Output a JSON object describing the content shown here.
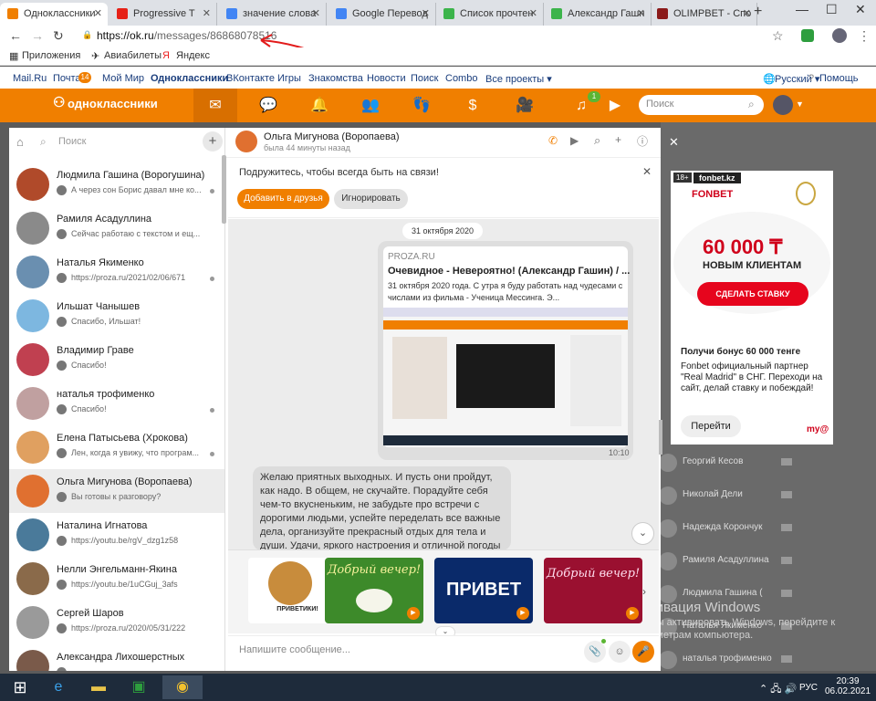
{
  "browser": {
    "tabs": [
      {
        "label": "Одноклассники",
        "color": "#f07f00",
        "active": true
      },
      {
        "label": "Progressive T",
        "color": "#e62117"
      },
      {
        "label": "значение слова",
        "color": "#4285f4"
      },
      {
        "label": "Google Перевод",
        "color": "#4285f4"
      },
      {
        "label": "Список прочтен",
        "color": "#3cb44b"
      },
      {
        "label": "Александр Гашн",
        "color": "#3cb44b"
      },
      {
        "label": "OLIMPBET - Спо",
        "color": "#8b1a1a"
      }
    ],
    "url_host": "https://ok.ru",
    "url_path": "/messages/86868078516",
    "bookmarks": [
      "Приложения",
      "Авиабилеты",
      "Яндекс"
    ]
  },
  "portal": {
    "links": [
      "Mail.Ru",
      "Почта",
      "Мой Мир",
      "Одноклассники",
      "ВКонтакте",
      "Игры",
      "Знакомства",
      "Новости",
      "Поиск",
      "Combo",
      "Все проекты ▾"
    ],
    "mail_badge": "14",
    "lang": "Русский ▾",
    "help": "Помощь"
  },
  "ok": {
    "logo": "одноклассники",
    "search_placeholder": "Поиск",
    "music_badge": "1"
  },
  "sidebar": {
    "search_placeholder": "Поиск",
    "chats": [
      {
        "name": "Людмила Гашина (Ворогушина)",
        "preview": "А через сон Борис давал мне ко...",
        "color": "#b04a2a"
      },
      {
        "name": "Рамиля Асадуллина",
        "preview": "Сейчас работаю с текстом и ещ...",
        "color": "#8a8a8a"
      },
      {
        "name": "Наталья Якименко",
        "preview": "https://proza.ru/2021/02/06/671",
        "color": "#6a8fb0"
      },
      {
        "name": "Ильшат Чанышев",
        "preview": "Спасибо, Ильшат!",
        "color": "#7db7e0"
      },
      {
        "name": "Владимир Граве",
        "preview": "Спасибо!",
        "color": "#c04050"
      },
      {
        "name": "наталья трофименко",
        "preview": "Спасибо!",
        "color": "#c0a0a0"
      },
      {
        "name": "Елена Патысьева (Хрокова)",
        "preview": "Лен, когда я увижу, что програм...",
        "color": "#e0a060"
      },
      {
        "name": "Ольга Мигунова (Воропаева)",
        "preview": "Вы готовы к разговору?",
        "color": "#e07030"
      },
      {
        "name": "Наталина Игнатова",
        "preview": "https://youtu.be/rgV_dzg1z58",
        "color": "#4a7a9a"
      },
      {
        "name": "Нелли Энгельманн-Якина",
        "preview": "https://youtu.be/1uCGuj_3afs",
        "color": "#8a6a4a"
      },
      {
        "name": "Сергей Шаров",
        "preview": "https://proza.ru/2020/05/31/222",
        "color": "#9a9a9a"
      },
      {
        "name": "Александра Лихошерстных",
        "preview": "",
        "color": "#7a5a4a"
      }
    ]
  },
  "header": {
    "name": "Ольга Мигунова (Воропаева)",
    "status": "была 44 минуты назад"
  },
  "friend_bar": {
    "text": "Подружитесь, чтобы всегда быть на связи!",
    "add": "Добавить в друзья",
    "ignore": "Игнорировать"
  },
  "messages": {
    "date": "31 октября 2020",
    "link_source": "PROZA.RU",
    "link_title": "Очевидное - Невероятно! (Александр Гашин) / ...",
    "link_desc": "31 октября 2020 года.       С утра я буду работать над чудесами с числами из фильма - Ученица Мессинга.      Э...",
    "time": "10:10",
    "text": "Желаю приятных выходных. И пусть они пройдут, как надо. В общем, не скучайте. Порадуйте себя чем-то вкусненьким, не забудьте про встречи с дорогими людьми, успейте переделать все важные дела, организуйте прекрасный отдых для тела и души. Удачи, яркого настроения и отличной погоды в эти"
  },
  "stickers": [
    "ПРИВЕТИКИ!",
    "Добрый вечер!",
    "ПРИВЕТ",
    "Добрый вечер!"
  ],
  "input": {
    "placeholder": "Напишите сообщение..."
  },
  "ad": {
    "brand": "fonbet.kz",
    "amount": "60 000 ₸",
    "new_clients": "НОВЫМ КЛИЕНТАМ",
    "cta": "СДЕЛАТЬ СТАВКУ",
    "title": "Получи бонус 60 000 тенге",
    "desc": "Fonbet официальный партнер \"Real Madrid\" в СНГ. Переходи на сайт, делай ставку и побеждай!",
    "go": "Перейти"
  },
  "right_list": [
    "Георгий Кесов",
    "Николай Дели",
    "Надежда Корончук",
    "Рамиля Асадуллина",
    "Людмила Гашина (",
    "Наталья Якименко",
    "наталья трофименко"
  ],
  "windows": {
    "activate": "Активация Windows",
    "activate_sub": "Чтобы активировать Windows, перейдите к параметрам компьютера.",
    "lang": "РУС",
    "time": "20:39",
    "date": "06.02.2021"
  }
}
